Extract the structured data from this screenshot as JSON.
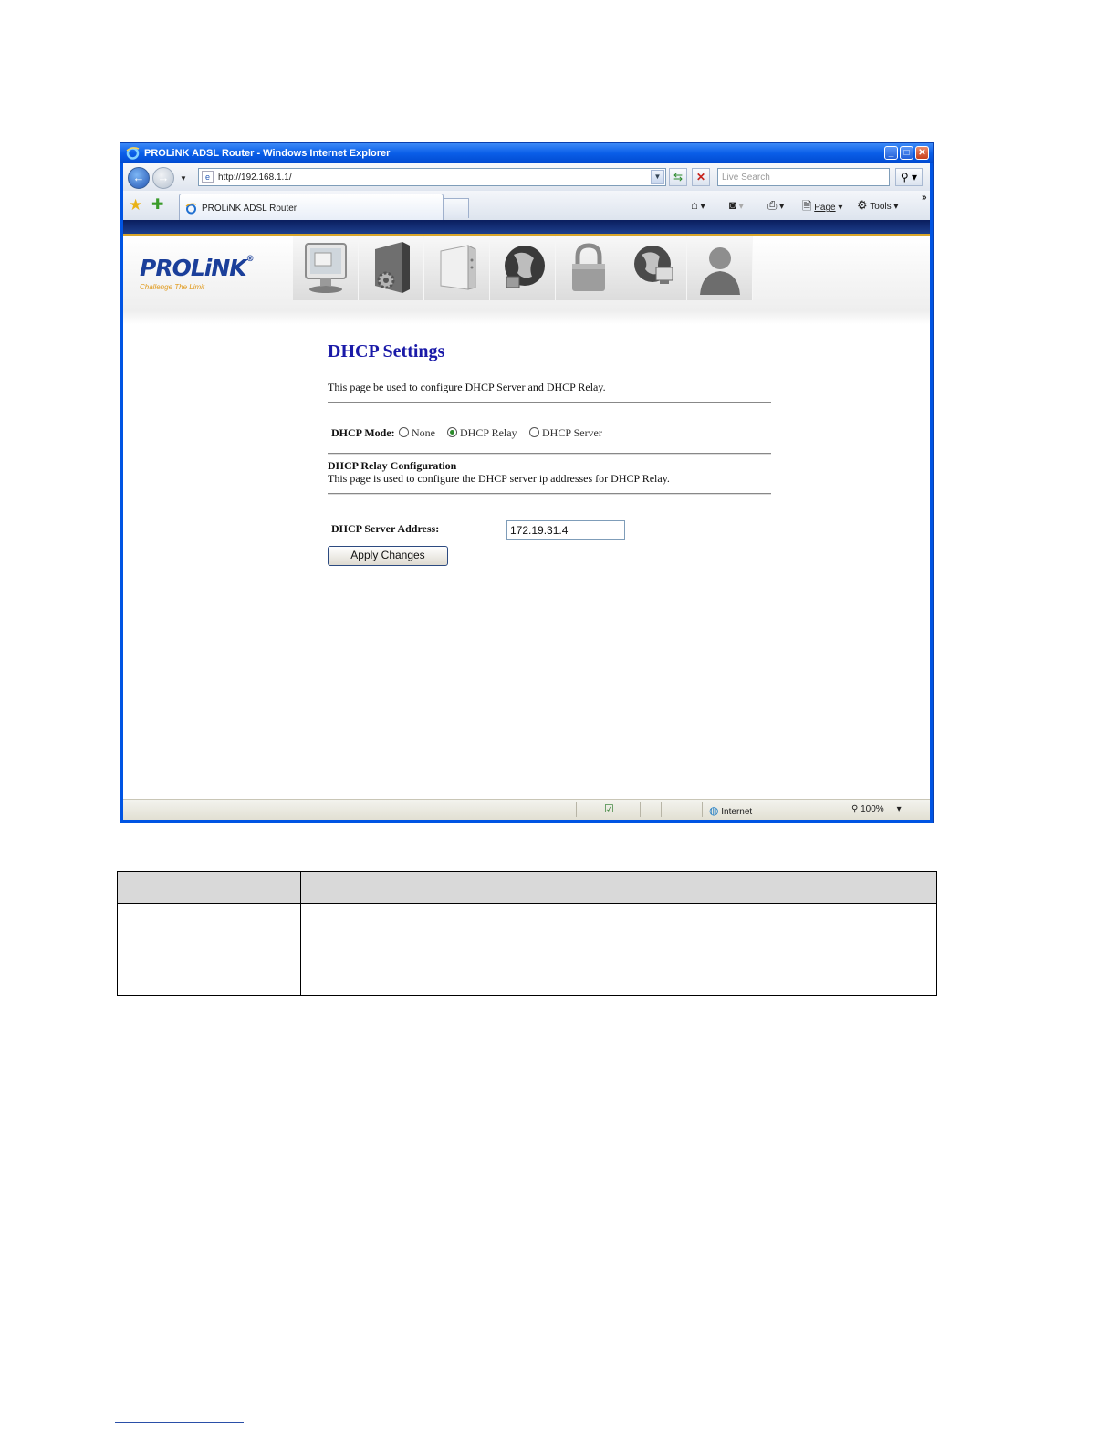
{
  "window": {
    "title": "PROLiNK ADSL Router - Windows Internet Explorer",
    "url": "http://192.168.1.1/",
    "search_placeholder": "Live Search",
    "tab_label": "PROLiNK ADSL Router",
    "commands": {
      "page": "Page",
      "tools": "Tools"
    },
    "status": {
      "zone": "Internet",
      "zoom": "100%"
    }
  },
  "brand": {
    "logo": "PROLiNK",
    "reg": "®",
    "tagline": "Challenge The Limit"
  },
  "menu_icons": [
    "status-icon",
    "setup-icon",
    "advance-icon",
    "service-icon",
    "firewall-icon",
    "maintenance-icon",
    "admin-icon"
  ],
  "page": {
    "title": "DHCP Settings",
    "intro": "This page be used to configure DHCP Server and DHCP Relay.",
    "mode_label": "DHCP Mode:",
    "modes": [
      {
        "label": "None",
        "selected": false
      },
      {
        "label": "DHCP Relay",
        "selected": true
      },
      {
        "label": "DHCP Server",
        "selected": false
      }
    ],
    "relay_title": "DHCP Relay Configuration",
    "relay_desc": "This page is used to configure the DHCP server ip addresses for DHCP Relay.",
    "server_address_label": "DHCP Server Address:",
    "server_address_value": "172.19.31.4",
    "apply_label": "Apply Changes"
  },
  "colors": {
    "title_blue": "#1a1aa8",
    "xp_blue": "#0054e3",
    "stripe_gold": "#d9a62a"
  }
}
